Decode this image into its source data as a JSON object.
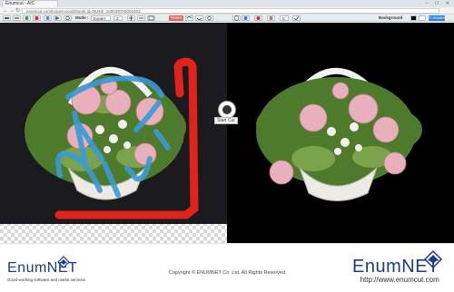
{
  "browser": {
    "tab_title": "Enumcut - AIC",
    "window_controls": "– ☐ ✕",
    "nav_back": "←",
    "nav_forward": "→",
    "nav_reload": "↻",
    "url": "enumcut.com/lygoemocedit/work.id=NUKE_200039700002402"
  },
  "toolbar": {
    "mode_label": "Mode :",
    "mode_value": "Expert",
    "size_value": "3",
    "reset_label": "Reset",
    "number_value": "0.",
    "background_label": "Background",
    "compare_label": "Compare"
  },
  "workspace": {
    "start_cut_label": "Start Cut"
  },
  "footer": {
    "brand": "EnumNET",
    "tagline": "Good-working software and useful services",
    "copyright": "Copyright © ENUMNET Co. Ltd. All Rights Reserved",
    "website": "http://www.enumcut.com"
  },
  "colors": {
    "brand_blue": "#1a3a8c",
    "marker_red": "#e0241b",
    "marker_blue": "#3b9ad8",
    "reset_red": "#e06666",
    "compare_blue": "#2a7be4"
  }
}
